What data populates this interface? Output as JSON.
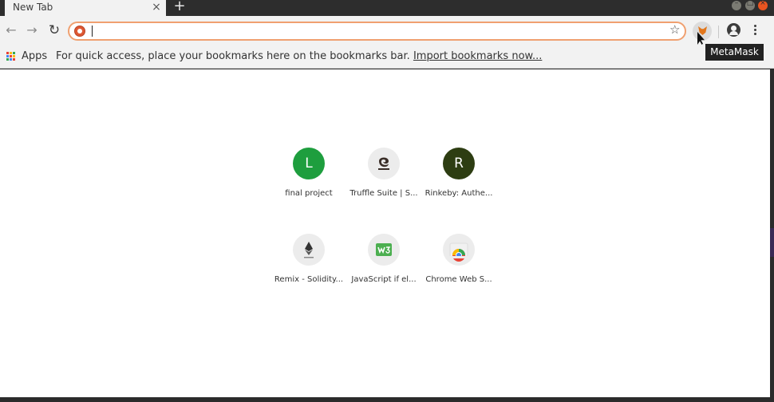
{
  "tab": {
    "title": "New Tab",
    "close_glyph": "×",
    "new_tab_glyph": "+"
  },
  "window_controls": {
    "minimize": "–",
    "maximize": "□",
    "close": "×"
  },
  "toolbar": {
    "back_glyph": "←",
    "forward_glyph": "→",
    "reload_glyph": "↻",
    "omnibox_value": "",
    "search_engine_icon": "duckduckgo-icon",
    "star_glyph": "☆",
    "extension_icon": "metamask-fox-icon"
  },
  "bookmarks_bar": {
    "apps_label": "Apps",
    "hint_text": "For quick access, place your bookmarks here on the bookmarks bar.",
    "import_link": "Import bookmarks now..."
  },
  "tooltip": {
    "text": "MetaMask"
  },
  "shortcuts": [
    {
      "label": "final project",
      "letter": "L",
      "icon_color": "#1e9e3e"
    },
    {
      "label": "Truffle Suite | S...",
      "icon": "truffle-icon"
    },
    {
      "label": "Rinkeby: Authe...",
      "letter": "R",
      "icon_color": "#2d3d12"
    },
    {
      "label": "Remix - Solidity...",
      "icon": "remix-ethereum-icon"
    },
    {
      "label": "JavaScript if el...",
      "icon": "w3schools-icon"
    },
    {
      "label": "Chrome Web S...",
      "icon": "chrome-web-store-icon"
    }
  ]
}
